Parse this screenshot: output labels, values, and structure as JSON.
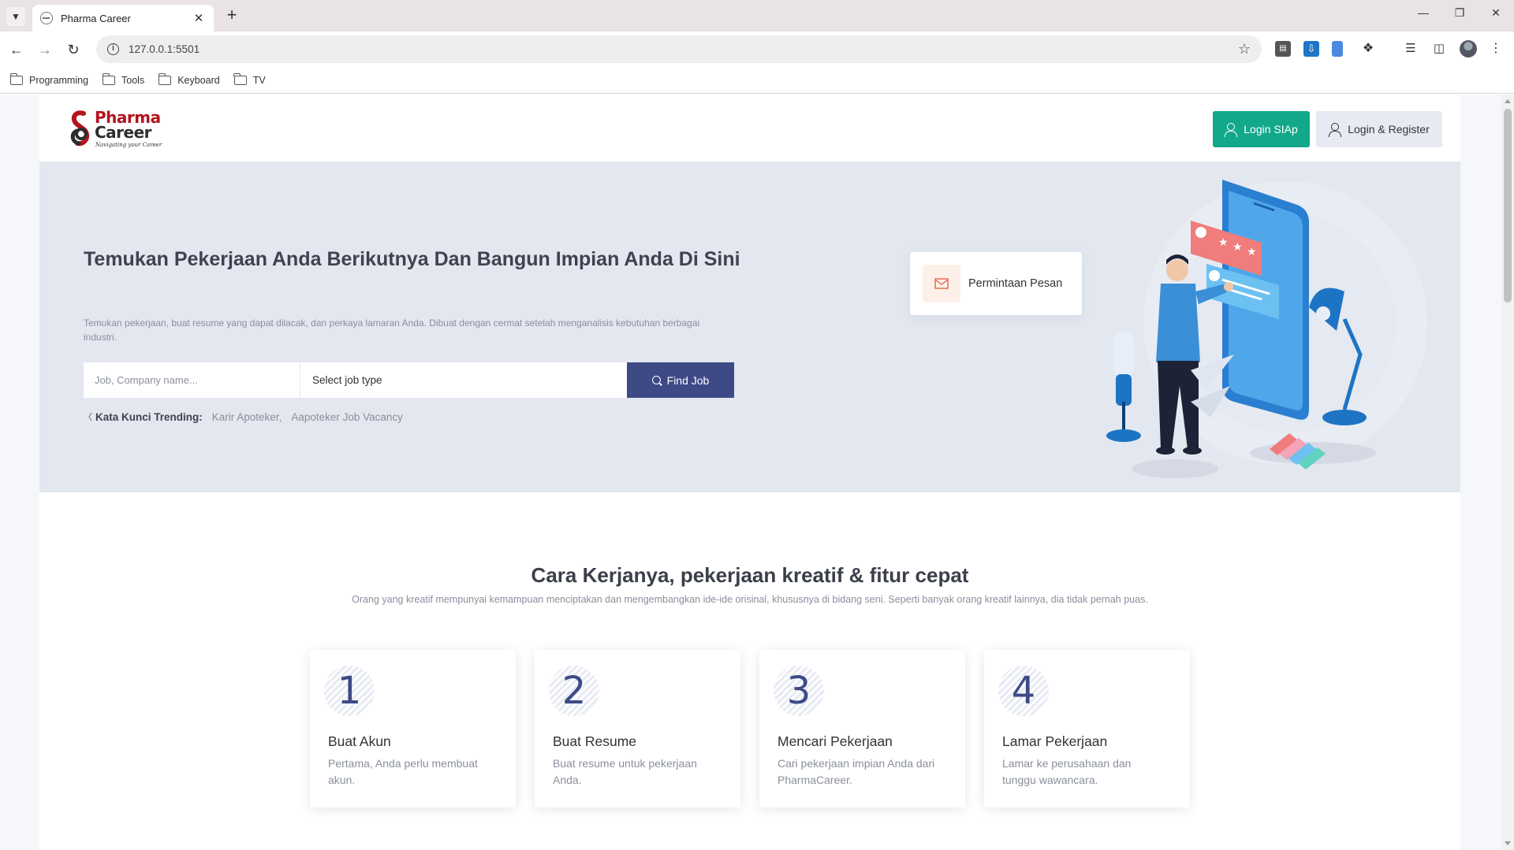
{
  "browser": {
    "tab_title": "Pharma Career",
    "url": "127.0.0.1:5501",
    "bookmarks": [
      {
        "label": "Programming"
      },
      {
        "label": "Tools"
      },
      {
        "label": "Keyboard"
      },
      {
        "label": "TV"
      }
    ]
  },
  "header": {
    "logo": {
      "word1": "Pharma",
      "word2": "Career",
      "tagline": "Navigating your Career"
    },
    "siap_button": "Login SIAp",
    "login_button": "Login & Register"
  },
  "hero": {
    "title": "Temukan Pekerjaan Anda Berikutnya Dan Bangun Impian Anda Di Sini",
    "description": "Temukan pekerjaan, buat resume yang dapat dilacak, dan perkaya lamaran Anda. Dibuat dengan cermat setelah menganalisis kebutuhan berbagai industri.",
    "search_placeholder": "Job, Company name...",
    "job_type": "Select job type",
    "find_button": "Find Job",
    "trending_label": "Kata Kunci Trending:",
    "trending_items": [
      "Karir Apoteker,",
      "Aapoteker Job Vacancy"
    ],
    "message_card": "Permintaan Pesan"
  },
  "how_it_works": {
    "title": "Cara Kerjanya, pekerjaan kreatif & fitur cepat",
    "description": "Orang yang kreatif mempunyai kemampuan menciptakan dan mengembangkan ide-ide orisinal, khususnya di bidang seni. Seperti banyak orang kreatif lainnya, dia tidak pernah puas.",
    "steps": [
      {
        "number": "1",
        "title": "Buat Akun",
        "desc": "Pertama, Anda perlu membuat akun."
      },
      {
        "number": "2",
        "title": "Buat Resume",
        "desc": "Buat resume untuk pekerjaan Anda."
      },
      {
        "number": "3",
        "title": "Mencari Pekerjaan",
        "desc": "Cari pekerjaan impian Anda dari PharmaCareer."
      },
      {
        "number": "4",
        "title": "Lamar Pekerjaan",
        "desc": "Lamar ke perusahaan dan tunggu wawancara."
      }
    ]
  },
  "colors": {
    "accent_green": "#13a88a",
    "accent_navy": "#3e4a86",
    "brand_red": "#b3141e",
    "hero_bg": "#e3e7ef"
  }
}
